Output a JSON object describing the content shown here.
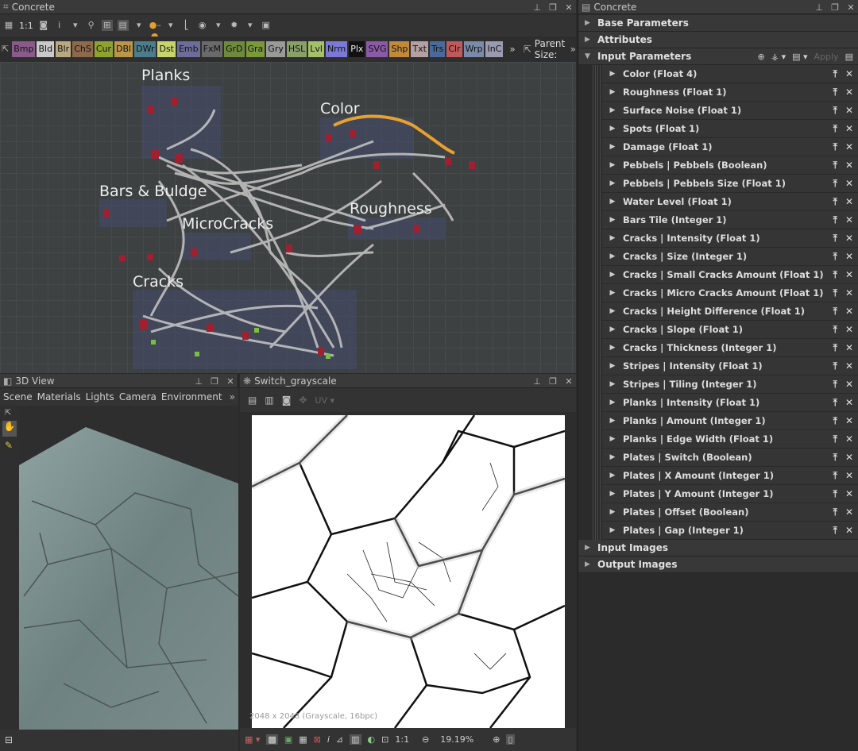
{
  "graph_panel": {
    "title": "Concrete",
    "toolbar": {
      "zoom_label": "1:1"
    },
    "node_buttons": [
      {
        "label": "Bmp",
        "color": "#8a5a8a"
      },
      {
        "label": "Bld",
        "color": "#c9c9c9"
      },
      {
        "label": "Blr",
        "color": "#b9a983"
      },
      {
        "label": "ChS",
        "color": "#8d6a4e"
      },
      {
        "label": "Cur",
        "color": "#8fa12e"
      },
      {
        "label": "DBl",
        "color": "#b9964a"
      },
      {
        "label": "DWr",
        "color": "#4d7d8a"
      },
      {
        "label": "Dst",
        "color": "#c8d46a"
      },
      {
        "label": "Emb",
        "color": "#6d6d9a"
      },
      {
        "label": "FxM",
        "color": "#6a6a6a"
      },
      {
        "label": "GrD",
        "color": "#6e8a3e"
      },
      {
        "label": "Gra",
        "color": "#7a9a3a"
      },
      {
        "label": "Gry",
        "color": "#9a9a9a"
      },
      {
        "label": "HSL",
        "color": "#8aa06a"
      },
      {
        "label": "Lvl",
        "color": "#a4c06a"
      },
      {
        "label": "Nrm",
        "color": "#7a7ad6"
      },
      {
        "label": "Plx",
        "color": "#111111"
      },
      {
        "label": "SVG",
        "color": "#8a5aa6"
      },
      {
        "label": "Shp",
        "color": "#c08a3a"
      },
      {
        "label": "Txt",
        "color": "#b4a0a0"
      },
      {
        "label": "Trs",
        "color": "#4a6a9a"
      },
      {
        "label": "Clr",
        "color": "#c05a5a"
      },
      {
        "label": "Wrp",
        "color": "#7a8aa8"
      },
      {
        "label": "InC",
        "color": "#9a9ab0"
      }
    ],
    "more_label": "»",
    "parent_size_label": "Parent Size:",
    "frames": [
      "Planks",
      "Color",
      "Bars & Buldge",
      "Roughness",
      "MicroCracks",
      "Cracks"
    ]
  },
  "view3d": {
    "title": "3D View",
    "menu": [
      "Scene",
      "Materials",
      "Lights",
      "Camera",
      "Environment"
    ]
  },
  "view2d": {
    "title": "Switch_grayscale",
    "uv_label": "UV",
    "image_info": "2048 x 2048 (Grayscale, 16bpc)",
    "zoom_ratio": "1:1",
    "zoom_percent": "19.19%"
  },
  "params_panel": {
    "title": "Concrete",
    "sections_top": [
      "Base Parameters",
      "Attributes"
    ],
    "input_section": "Input Parameters",
    "apply_label": "Apply",
    "parameters": [
      "Color (Float 4)",
      "Roughness (Float 1)",
      "Surface Noise (Float 1)",
      "Spots (Float 1)",
      "Damage (Float 1)",
      "Pebbels | Pebbels (Boolean)",
      "Pebbels | Pebbels Size (Float 1)",
      "Water Level (Float 1)",
      "Bars Tile (Integer 1)",
      "Cracks | Intensity (Float 1)",
      "Cracks | Size (Integer 1)",
      "Cracks | Small Cracks Amount (Float 1)",
      "Cracks | Micro Cracks Amount (Float 1)",
      "Cracks | Height Difference (Float 1)",
      "Cracks | Slope (Float 1)",
      "Cracks | Thickness (Integer 1)",
      "Stripes | Intensity (Float 1)",
      "Stripes | Tiling (Integer 1)",
      "Planks | Intensity (Float 1)",
      "Planks | Amount (Integer 1)",
      "Planks | Edge Width (Float 1)",
      "Plates | Switch (Boolean)",
      "Plates | X Amount (Integer 1)",
      "Plates | Y Amount (Integer 1)",
      "Plates | Offset (Boolean)",
      "Plates | Gap (Integer 1)"
    ],
    "sections_bottom": [
      "Input Images",
      "Output Images"
    ]
  }
}
